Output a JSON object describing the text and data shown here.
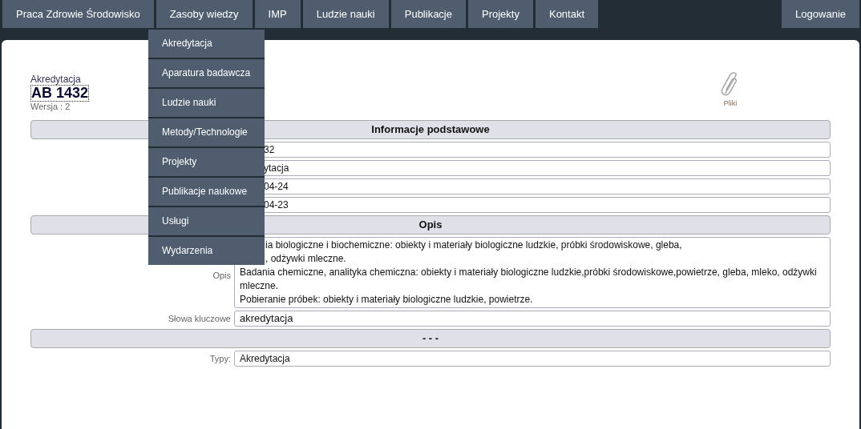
{
  "nav": {
    "items": [
      {
        "label": "Praca Zdrowie Środowisko"
      },
      {
        "label": "Zasoby wiedzy"
      },
      {
        "label": "IMP"
      },
      {
        "label": "Ludzie nauki"
      },
      {
        "label": "Publikacje"
      },
      {
        "label": "Projekty"
      },
      {
        "label": "Kontakt"
      }
    ],
    "login": "Logowanie"
  },
  "dropdown": {
    "items": [
      "Akredytacja",
      "Aparatura badawcza",
      "Ludzie nauki",
      "Metody/Technologie",
      "Projekty",
      "Publikacje naukowe",
      "Usługi",
      "Wydarzenia"
    ]
  },
  "record": {
    "type_label": "Akredytacja",
    "code": "AB 1432",
    "version": "Wersja : 2"
  },
  "attachments": {
    "label": "Pliki"
  },
  "info": {
    "title": "Informacje podstawowe",
    "values": [
      "32",
      "ytacja",
      "04-24",
      "04-23"
    ]
  },
  "description": {
    "title": "Opis",
    "label": "Opis",
    "lines": [
      {
        "kind": "cut",
        "text": "ia biologiczne i biochemiczne: obiekty i materiały biologiczne ludzkie, próbki środowiskowe, gleba,"
      },
      {
        "kind": "cut",
        "text": ", odżywki mleczne."
      },
      {
        "kind": "full",
        "text": "Badania chemiczne, analityka chemiczna: obiekty i materiały biologiczne ludzkie,próbki środowiskowe,powietrze, gleba, mleko, odżywki mleczne."
      },
      {
        "kind": "full",
        "text": "Pobieranie próbek: obiekty i materiały biologiczne ludzkie, powietrze."
      }
    ]
  },
  "keywords": {
    "label": "Słowa kluczowe",
    "value": "akredytacja"
  },
  "other": {
    "title": "- - -",
    "types_label": "Typy:",
    "types_value": "Akredytacja"
  }
}
